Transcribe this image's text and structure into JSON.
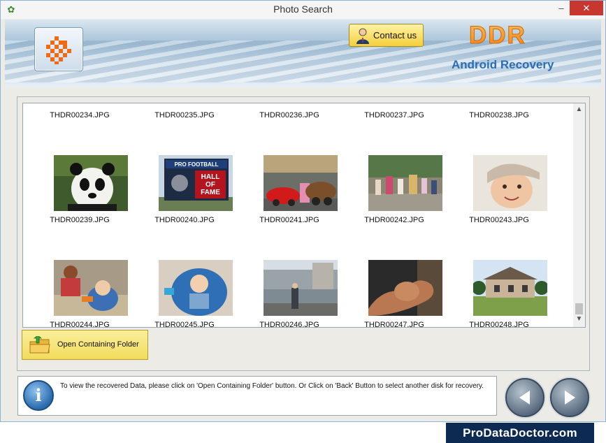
{
  "window": {
    "title": "Photo Search",
    "minimize_glyph": "–",
    "close_glyph": "✕"
  },
  "header": {
    "contact_label": "Contact us",
    "brand": "DDR",
    "product": "Android Recovery"
  },
  "gallery": {
    "items": [
      {
        "name": "THDR00234.JPG"
      },
      {
        "name": "THDR00235.JPG"
      },
      {
        "name": "THDR00236.JPG"
      },
      {
        "name": "THDR00237.JPG"
      },
      {
        "name": "THDR00238.JPG"
      },
      {
        "name": "THDR00239.JPG",
        "thumb": "panda"
      },
      {
        "name": "THDR00240.JPG",
        "thumb": "pro-football-hall-of-fame",
        "sign_lines": [
          "PRO FOOTBALL",
          "HALL",
          "OF",
          "FAME"
        ]
      },
      {
        "name": "THDR00241.JPG",
        "thumb": "cars-characters"
      },
      {
        "name": "THDR00242.JPG",
        "thumb": "parade"
      },
      {
        "name": "THDR00243.JPG",
        "thumb": "child-face"
      },
      {
        "name": "THDR00244.JPG",
        "thumb": "baby-with-woman"
      },
      {
        "name": "THDR00245.JPG",
        "thumb": "baby-in-seat"
      },
      {
        "name": "THDR00246.JPG",
        "thumb": "waterfront"
      },
      {
        "name": "THDR00247.JPG",
        "thumb": "bicep"
      },
      {
        "name": "THDR00248.JPG",
        "thumb": "house"
      }
    ]
  },
  "actions": {
    "open_folder_label": "Open Containing Folder"
  },
  "info": {
    "text": "To view the recovered Data, please click on 'Open Containing Folder' button. Or Click on 'Back' Button to select another disk for recovery."
  },
  "footer": {
    "site": "ProDataDoctor.com"
  },
  "colors": {
    "accent_orange": "#f08a1c",
    "brand_blue": "#2b6db5",
    "button_gold": "#f2dc5c",
    "footer_navy": "#0d2a52"
  }
}
